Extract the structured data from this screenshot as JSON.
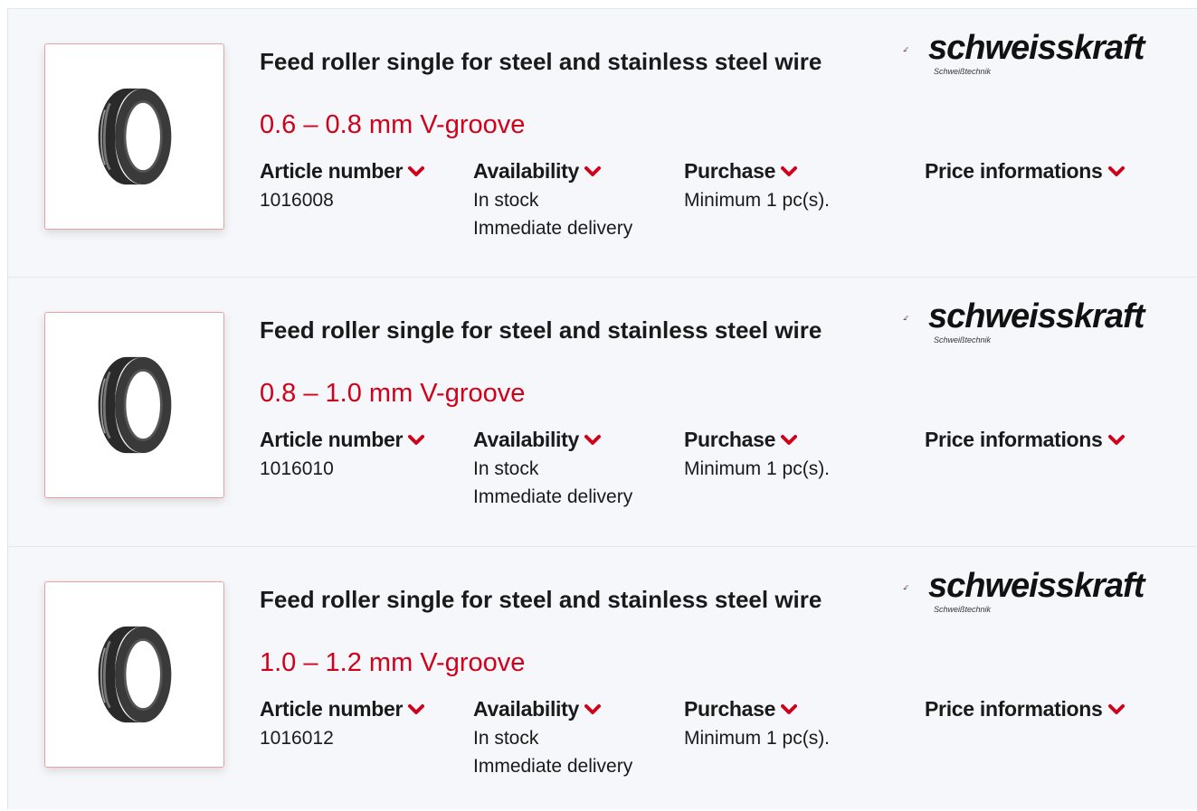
{
  "brand": {
    "name": "schweisskraft",
    "tagline": "Schweißtechnik"
  },
  "colors": {
    "accent": "#d0021b",
    "card_bg": "#f5f7fa"
  },
  "labels": {
    "article_number": "Article number",
    "availability": "Availability",
    "purchase": "Purchase",
    "price_info": "Price informations"
  },
  "products": [
    {
      "title": "Feed roller single for steel and stainless steel wire",
      "variant": "0.6 – 0.8 mm V-groove",
      "article_number": "1016008",
      "availability_status": "In stock",
      "availability_delivery": "Immediate delivery",
      "purchase": "Minimum 1 pc(s)."
    },
    {
      "title": "Feed roller single for steel and stainless steel wire",
      "variant": "0.8 – 1.0 mm V-groove",
      "article_number": "1016010",
      "availability_status": "In stock",
      "availability_delivery": "Immediate delivery",
      "purchase": "Minimum 1 pc(s)."
    },
    {
      "title": "Feed roller single for steel and stainless steel wire",
      "variant": "1.0 – 1.2 mm V-groove",
      "article_number": "1016012",
      "availability_status": "In stock",
      "availability_delivery": "Immediate delivery",
      "purchase": "Minimum 1 pc(s)."
    }
  ]
}
